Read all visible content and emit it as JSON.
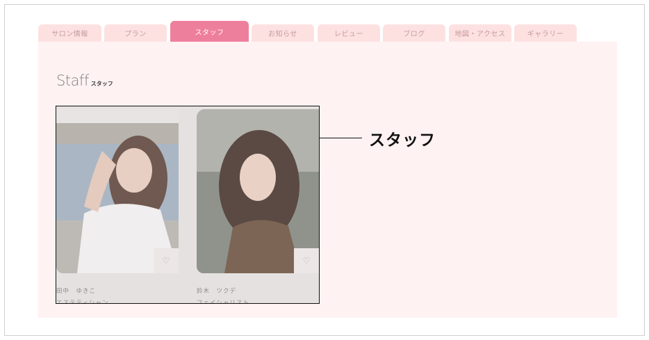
{
  "tabs": [
    {
      "label": "サロン情報",
      "active": false
    },
    {
      "label": "プラン",
      "active": false
    },
    {
      "label": "スタッフ",
      "active": true
    },
    {
      "label": "お知らせ",
      "active": false
    },
    {
      "label": "レビュー",
      "active": false
    },
    {
      "label": "ブログ",
      "active": false
    },
    {
      "label": "地図・アクセス",
      "active": false
    },
    {
      "label": "ギャラリー",
      "active": false
    }
  ],
  "section": {
    "title_en": "Staff",
    "title_jp": "スタッフ"
  },
  "staff": [
    {
      "name": "田中　ゆきこ",
      "role": "エステティシャン",
      "favorite_icon": "heart-icon"
    },
    {
      "name": "鈴木　ツクデ",
      "role": "フェイシャリスト",
      "favorite_icon": "heart-icon"
    }
  ],
  "callout": {
    "label": "スタッフ"
  },
  "colors": {
    "accent": "#ee7f9c",
    "tab_bg": "#fde1e1",
    "panel_bg": "#fff2f2"
  }
}
